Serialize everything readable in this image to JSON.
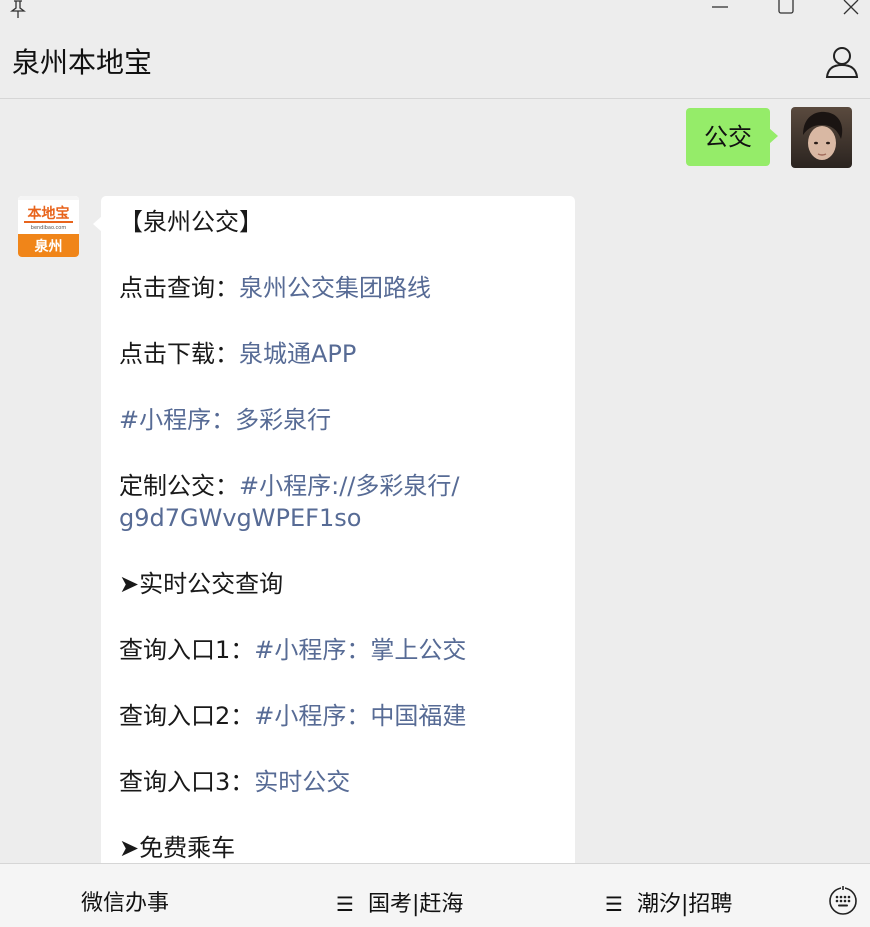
{
  "window": {
    "pin_icon": "pin-icon",
    "min_icon": "minimize-icon",
    "max_icon": "maximize-icon",
    "close_icon": "close-icon"
  },
  "header": {
    "title": "泉州本地宝",
    "profile_icon": "person-icon"
  },
  "chat": {
    "sent_message": "公交",
    "bot_avatar": {
      "logo_top": "本地宝",
      "logo_url": "bendibao.com",
      "logo_city": "泉州"
    },
    "reply": {
      "l1": "【泉州公交】",
      "l2_prefix": "点击查询：",
      "l2_link": "泉州公交集团路线",
      "l3_prefix": "点击下载：",
      "l3_link": "泉城通APP",
      "l4_link": "#小程序：多彩泉行",
      "l5_prefix": "定制公交：",
      "l5_link_a": "#小程序://多彩泉行/",
      "l5_link_b": "g9d7GWvgWPEF1so",
      "l6": "➤实时公交查询",
      "l7_prefix": "查询入口1：",
      "l7_link": "#小程序：掌上公交",
      "l8_prefix": "查询入口2：",
      "l8_link": "#小程序：中国福建",
      "l9_prefix": "查询入口3：",
      "l9_link": "实时公交",
      "l10": "➤免费乘车"
    }
  },
  "menu": {
    "item1": "微信办事",
    "item2": "国考|赶海",
    "item3": "潮汐|招聘",
    "hamburger": "☰",
    "keyboard_icon": "keyboard-icon"
  },
  "colors": {
    "sent_bubble": "#95ec69",
    "link": "#576b95",
    "background": "#ededed"
  }
}
